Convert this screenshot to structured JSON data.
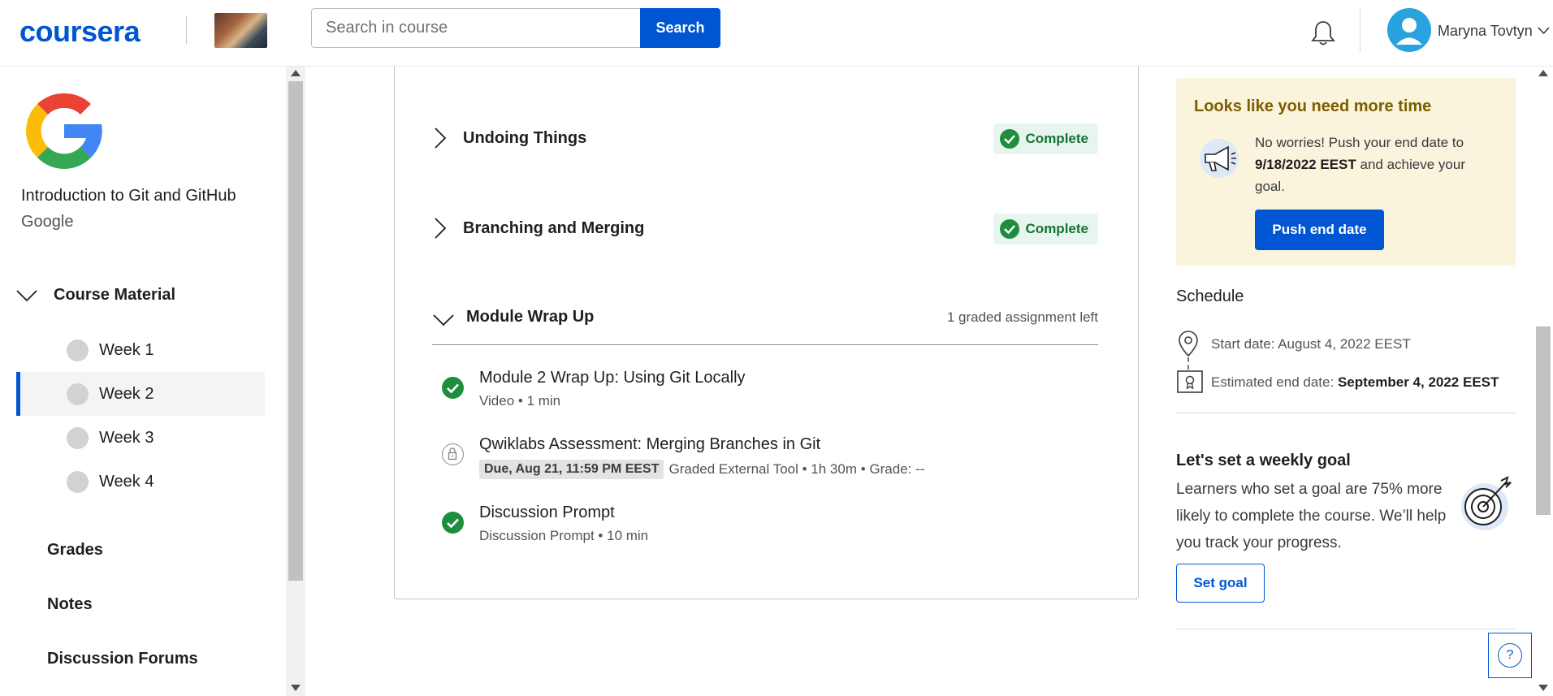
{
  "header": {
    "logo": "coursera",
    "search_placeholder": "Search in course",
    "search_button": "Search",
    "user_name": "Maryna Tovtyn"
  },
  "sidebar": {
    "course_title": "Introduction to Git and GitHub",
    "partner": "Google",
    "section_label": "Course Material",
    "weeks": [
      {
        "label": "Week 1"
      },
      {
        "label": "Week 2"
      },
      {
        "label": "Week 3"
      },
      {
        "label": "Week 4"
      }
    ],
    "active_week": "Week 2",
    "links": [
      "Grades",
      "Notes",
      "Discussion Forums"
    ]
  },
  "main": {
    "lessons": [
      {
        "title": "Undoing Things",
        "status": "Complete"
      },
      {
        "title": "Branching and Merging",
        "status": "Complete"
      }
    ],
    "expanded_lesson": {
      "title": "Module Wrap Up",
      "status_text": "1 graded assignment left",
      "items": [
        {
          "title": "Module 2 Wrap Up: Using Git Locally",
          "meta": "Video • 1 min",
          "state": "complete"
        },
        {
          "title": "Qwiklabs Assessment: Merging Branches in Git",
          "due": "Due, Aug 21, 11:59 PM EEST",
          "meta": "Graded External Tool • 1h 30m • Grade: --",
          "state": "locked"
        },
        {
          "title": "Discussion Prompt",
          "meta": "Discussion Prompt • 10 min",
          "state": "complete"
        }
      ]
    }
  },
  "right": {
    "more_time": {
      "title": "Looks like you need more time",
      "text_prefix": "No worries! Push your end date to",
      "date": "9/18/2022 EEST",
      "text_suffix": "and achieve your goal.",
      "button": "Push end date"
    },
    "schedule": {
      "heading": "Schedule",
      "start": "Start date: August 4, 2022 EEST",
      "end_label": "Estimated end date:",
      "end_value": "September 4, 2022 EEST"
    },
    "goal": {
      "heading": "Let's set a weekly goal",
      "text": "Learners who set a goal are 75% more likely to complete the course. We’ll help you track your progress.",
      "button": "Set goal"
    },
    "help": "?"
  },
  "colors": {
    "brand": "#0056d2",
    "complete_green": "#1e8e3e",
    "warning_bg": "#fbf4dc",
    "warning_title": "#7a5e00"
  }
}
